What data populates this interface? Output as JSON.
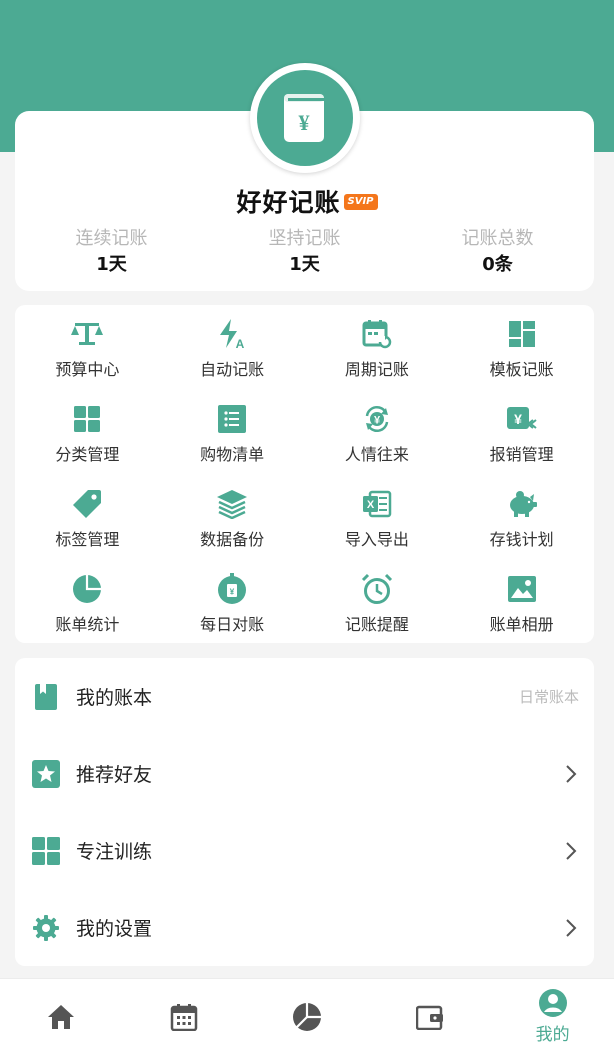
{
  "profile": {
    "app_name": "好好记账",
    "vip_badge": "SVIP",
    "stats": [
      {
        "label": "连续记账",
        "value": "1天"
      },
      {
        "label": "坚持记账",
        "value": "1天"
      },
      {
        "label": "记账总数",
        "value": "0条"
      }
    ]
  },
  "features": [
    {
      "label": "预算中心",
      "icon": "scale-icon"
    },
    {
      "label": "自动记账",
      "icon": "auto-bolt-icon"
    },
    {
      "label": "周期记账",
      "icon": "calendar-repeat-icon"
    },
    {
      "label": "模板记账",
      "icon": "template-icon"
    },
    {
      "label": "分类管理",
      "icon": "category-grid-icon"
    },
    {
      "label": "购物清单",
      "icon": "list-icon"
    },
    {
      "label": "人情往来",
      "icon": "yuan-exchange-icon"
    },
    {
      "label": "报销管理",
      "icon": "reimburse-icon"
    },
    {
      "label": "标签管理",
      "icon": "tag-icon"
    },
    {
      "label": "数据备份",
      "icon": "layers-icon"
    },
    {
      "label": "导入导出",
      "icon": "excel-icon"
    },
    {
      "label": "存钱计划",
      "icon": "piggy-bank-icon"
    },
    {
      "label": "账单统计",
      "icon": "pie-chart-icon"
    },
    {
      "label": "每日对账",
      "icon": "daily-check-icon"
    },
    {
      "label": "记账提醒",
      "icon": "alarm-clock-icon"
    },
    {
      "label": "账单相册",
      "icon": "image-icon"
    }
  ],
  "menu": {
    "my_books": {
      "label": "我的账本",
      "extra": "日常账本"
    },
    "recommend": {
      "label": "推荐好友"
    },
    "focus": {
      "label": "专注训练"
    },
    "settings": {
      "label": "我的设置"
    }
  },
  "tabbar": {
    "active_label": "我的"
  },
  "colors": {
    "accent": "#4caa93",
    "vip": "#f4761b"
  }
}
